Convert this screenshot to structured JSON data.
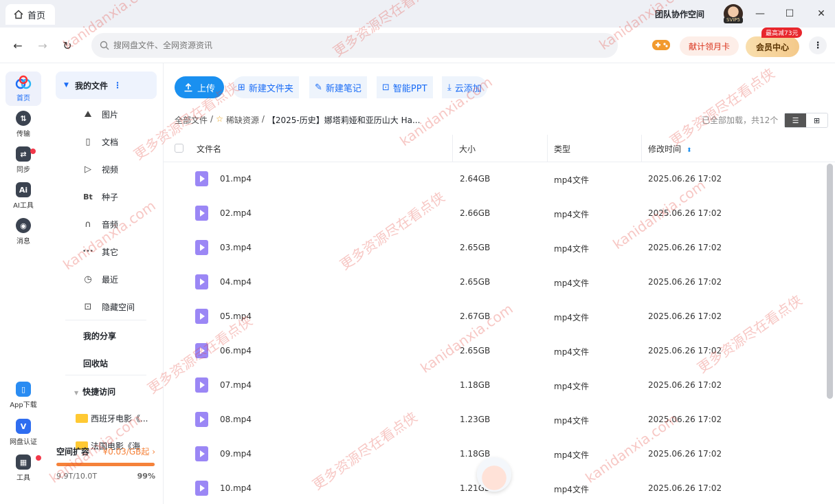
{
  "titlebar": {
    "tab_label": "首页",
    "team_label": "团队协作空间",
    "avatar_badge": "SVIP5"
  },
  "nav": {
    "search_placeholder": "搜网盘文件、全网资源资讯",
    "month_card": "献计领月卡",
    "vip_center": "会员中心",
    "promo": "最高减73元"
  },
  "rail": [
    {
      "label": "首页",
      "icon": "home-cloud-icon",
      "color": "#1a6cf6",
      "active": true
    },
    {
      "label": "传输",
      "icon": "transfer-icon",
      "color": "#3b4350"
    },
    {
      "label": "同步",
      "icon": "sync-icon",
      "color": "#3b4350"
    },
    {
      "label": "AI工具",
      "icon": "ai-icon",
      "color": "#3b4350"
    },
    {
      "label": "消息",
      "icon": "message-icon",
      "color": "#3b4350"
    }
  ],
  "rail_bottom": [
    {
      "label": "App下载",
      "icon": "phone-icon",
      "color": "#2a8cf2"
    },
    {
      "label": "网盘认证",
      "icon": "verify-icon",
      "color": "#2f6df0"
    },
    {
      "label": "工具",
      "icon": "tools-icon",
      "color": "#3b4350"
    }
  ],
  "sidebar": {
    "header": "我的文件",
    "items": [
      {
        "label": "图片",
        "icon": "image-icon",
        "glyph": "⛰"
      },
      {
        "label": "文档",
        "icon": "document-icon",
        "glyph": "▯"
      },
      {
        "label": "视频",
        "icon": "video-icon",
        "glyph": "▷"
      },
      {
        "label": "种子",
        "icon": "torrent-icon",
        "glyph": "Bt"
      },
      {
        "label": "音频",
        "icon": "audio-icon",
        "glyph": "∩"
      },
      {
        "label": "其它",
        "icon": "other-icon",
        "glyph": "•••"
      },
      {
        "label": "最近",
        "icon": "recent-icon",
        "glyph": "◷"
      },
      {
        "label": "隐藏空间",
        "icon": "lock-icon",
        "glyph": "🔒"
      }
    ],
    "my_share": "我的分享",
    "recycle": "回收站",
    "quick_access": "快捷访问",
    "quick_items": [
      "西班牙电影《...",
      "法国电影《海"
    ],
    "quota_title": "空间扩容",
    "quota_price": "¥0.03/GB起",
    "quota_usage": "9.9T/10.0T",
    "quota_percent": "99%",
    "quota_fill": 0.99
  },
  "toolbar": {
    "upload": "上传",
    "new_folder": "新建文件夹",
    "new_note": "新建笔记",
    "smart_ppt": "智能PPT",
    "cloud_add": "云添加"
  },
  "breadcrumb": {
    "root": "全部文件",
    "mid": "稀缺资源",
    "last": "【2025-历史】娜塔莉娅和亚历山大 Ha..."
  },
  "status": {
    "loaded": "已全部加载，共12个"
  },
  "table": {
    "headers": {
      "name": "文件名",
      "size": "大小",
      "type": "类型",
      "modified": "修改时间"
    },
    "rows": [
      {
        "name": "01.mp4",
        "size": "2.64GB",
        "type": "mp4文件",
        "modified": "2025.06.26 17:02"
      },
      {
        "name": "02.mp4",
        "size": "2.66GB",
        "type": "mp4文件",
        "modified": "2025.06.26 17:02"
      },
      {
        "name": "03.mp4",
        "size": "2.65GB",
        "type": "mp4文件",
        "modified": "2025.06.26 17:02"
      },
      {
        "name": "04.mp4",
        "size": "2.65GB",
        "type": "mp4文件",
        "modified": "2025.06.26 17:02"
      },
      {
        "name": "05.mp4",
        "size": "2.67GB",
        "type": "mp4文件",
        "modified": "2025.06.26 17:02"
      },
      {
        "name": "06.mp4",
        "size": "2.65GB",
        "type": "mp4文件",
        "modified": "2025.06.26 17:02"
      },
      {
        "name": "07.mp4",
        "size": "1.18GB",
        "type": "mp4文件",
        "modified": "2025.06.26 17:02"
      },
      {
        "name": "08.mp4",
        "size": "1.23GB",
        "type": "mp4文件",
        "modified": "2025.06.26 17:02"
      },
      {
        "name": "09.mp4",
        "size": "1.18GB",
        "type": "mp4文件",
        "modified": "2025.06.26 17:02"
      },
      {
        "name": "10.mp4",
        "size": "1.21GB",
        "type": "mp4文件",
        "modified": "2025.06.26 17:02"
      }
    ]
  },
  "watermark": {
    "a": "kanidanxia.com",
    "b": "更多资源尽在看点侠"
  }
}
